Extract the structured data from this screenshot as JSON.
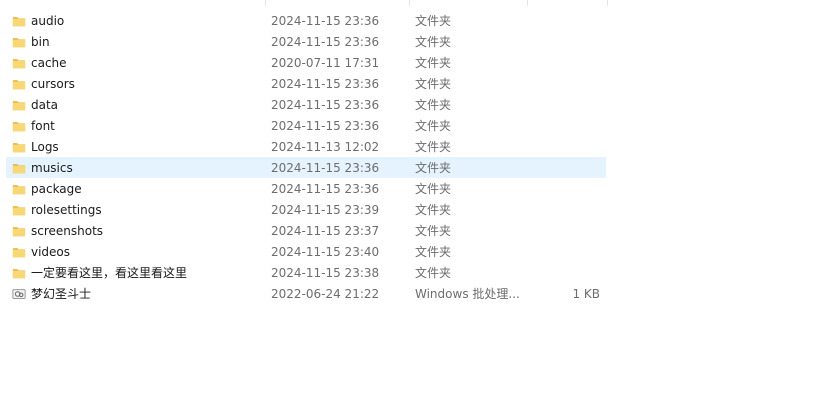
{
  "files": [
    {
      "name": "audio",
      "date": "2024-11-15 23:36",
      "type": "文件夹",
      "size": "",
      "icon": "folder-icon"
    },
    {
      "name": "bin",
      "date": "2024-11-15 23:36",
      "type": "文件夹",
      "size": "",
      "icon": "folder-icon"
    },
    {
      "name": "cache",
      "date": "2020-07-11 17:31",
      "type": "文件夹",
      "size": "",
      "icon": "folder-icon"
    },
    {
      "name": "cursors",
      "date": "2024-11-15 23:36",
      "type": "文件夹",
      "size": "",
      "icon": "folder-icon"
    },
    {
      "name": "data",
      "date": "2024-11-15 23:36",
      "type": "文件夹",
      "size": "",
      "icon": "folder-icon"
    },
    {
      "name": "font",
      "date": "2024-11-15 23:36",
      "type": "文件夹",
      "size": "",
      "icon": "folder-icon"
    },
    {
      "name": "Logs",
      "date": "2024-11-13 12:02",
      "type": "文件夹",
      "size": "",
      "icon": "folder-icon"
    },
    {
      "name": "musics",
      "date": "2024-11-15 23:36",
      "type": "文件夹",
      "size": "",
      "icon": "folder-icon",
      "selected": true
    },
    {
      "name": "package",
      "date": "2024-11-15 23:36",
      "type": "文件夹",
      "size": "",
      "icon": "folder-icon"
    },
    {
      "name": "rolesettings",
      "date": "2024-11-15 23:39",
      "type": "文件夹",
      "size": "",
      "icon": "folder-icon"
    },
    {
      "name": "screenshots",
      "date": "2024-11-15 23:37",
      "type": "文件夹",
      "size": "",
      "icon": "folder-icon"
    },
    {
      "name": "videos",
      "date": "2024-11-15 23:40",
      "type": "文件夹",
      "size": "",
      "icon": "folder-icon"
    },
    {
      "name": "一定要看这里，看这里看这里",
      "date": "2024-11-15 23:38",
      "type": "文件夹",
      "size": "",
      "icon": "folder-icon"
    },
    {
      "name": "梦幻圣斗士",
      "date": "2022-06-24 21:22",
      "type": "Windows 批处理...",
      "size": "1 KB",
      "icon": "batch-file-icon"
    }
  ],
  "colors": {
    "selected_row": "#e5f3ff",
    "folder_fill": "#f8d775",
    "folder_tab": "#e8b84a",
    "secondary_text": "#6d6d6d"
  }
}
